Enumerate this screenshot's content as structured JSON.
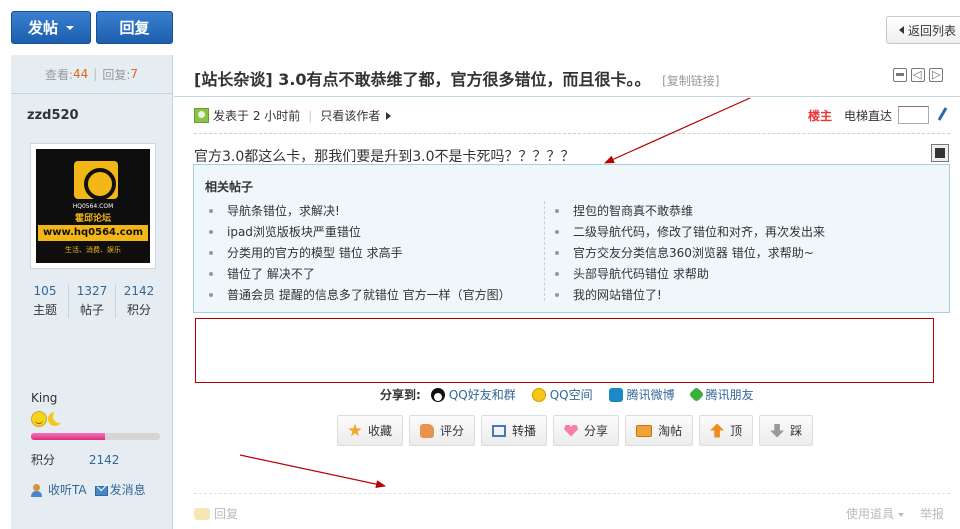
{
  "toolbar": {
    "post_label": "发帖",
    "reply_label": "回复",
    "back_label": "返回列表"
  },
  "sidebar": {
    "views_label": "查看:",
    "views": "44",
    "replies_label": "回复:",
    "replies": "7",
    "author_name": "zzd520",
    "avatar": {
      "url_small": "HQ0564.COM",
      "title": "霍邱论坛",
      "url": "www.hq0564.com",
      "slogan": "生活、消费、娱乐"
    },
    "user_stats": [
      {
        "value": "105",
        "label": "主题"
      },
      {
        "value": "1327",
        "label": "帖子"
      },
      {
        "value": "2142",
        "label": "积分"
      }
    ],
    "group": "King",
    "credit_progress": 0.57,
    "credit_label": "积分",
    "credit_value": "2142",
    "follow_label": "收听TA",
    "message_label": "发消息"
  },
  "thread": {
    "title": "[站长杂谈] 3.0有点不敢恭维了都，官方很多错位，而且很卡。。",
    "copy_link": "[复制链接]"
  },
  "meta": {
    "posted": "发表于 2 小时前",
    "only_author": "只看该作者",
    "floor": "楼主",
    "elevator": "电梯直达"
  },
  "post": {
    "text": "官方3.0都这么卡，那我们要是升到3.0不是卡死吗？？？？？"
  },
  "related": {
    "title": "相关帖子",
    "left": [
      "导航条错位，求解决!",
      "ipad浏览版板块严重错位",
      "分类用的官方的模型 错位 求高手",
      "错位了 解决不了",
      "普通会员 提醒的信息多了就错位 官方一样（官方图）"
    ],
    "right": [
      "捏包的智商真不敢恭维",
      "二级导航代码，修改了错位和对齐，再次发出来",
      "官方交友分类信息360浏览器 错位，求帮助~",
      "头部导航代码错位 求帮助",
      "我的网站错位了!"
    ]
  },
  "share": {
    "label": "分享到:",
    "links": [
      "QQ好友和群",
      "QQ空间",
      "腾讯微博",
      "腾讯朋友"
    ]
  },
  "actions": [
    "收藏",
    "评分",
    "转播",
    "分享",
    "淘帖",
    "顶",
    "踩"
  ],
  "footer": {
    "reply": "回复",
    "tools": "使用道具",
    "report": "举报"
  },
  "colors": {
    "primary_button": "#1d5fae",
    "sidebar_bg": "#e5edf2",
    "related_bg": "#f0f7fb",
    "annotation_red": "#b80000",
    "floor_red": "#e33333",
    "credit_bar": "#dd2c85"
  }
}
